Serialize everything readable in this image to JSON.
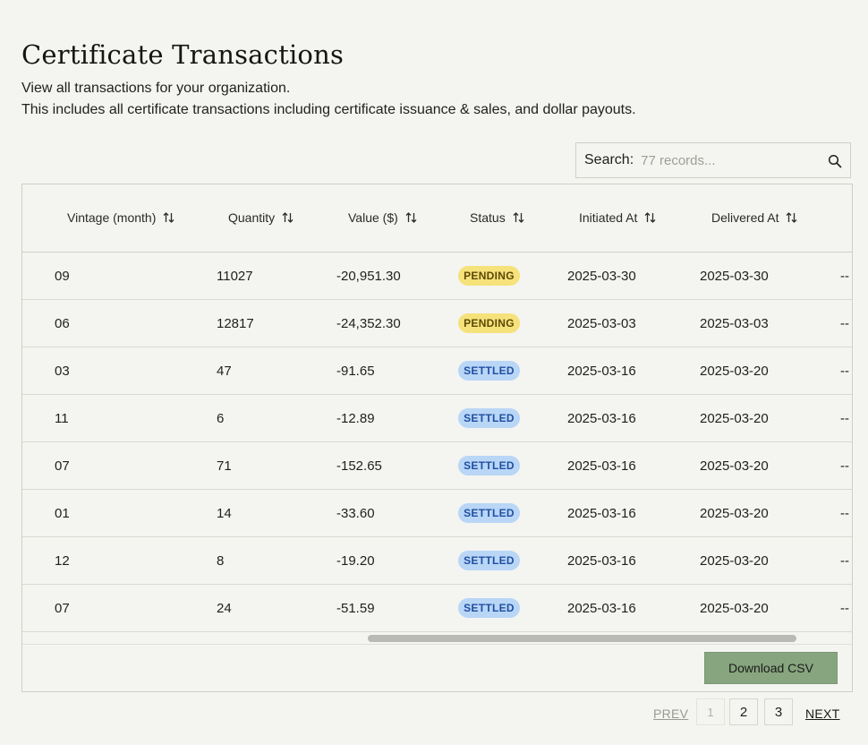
{
  "page": {
    "title": "Certificate Transactions",
    "subtitle_line1": "View all transactions for your organization.",
    "subtitle_line2": "This includes all certificate transactions including certificate issuance & sales, and dollar payouts."
  },
  "search": {
    "label": "Search:",
    "placeholder": "77 records..."
  },
  "table": {
    "columns": [
      "Vintage (month)",
      "Quantity",
      "Value ($)",
      "Status",
      "Initiated At",
      "Delivered At"
    ],
    "rows": [
      {
        "vintage": "09",
        "quantity": "11027",
        "value": "-20,951.30",
        "status": "PENDING",
        "initiated": "2025-03-30",
        "delivered": "2025-03-30",
        "extra": "--"
      },
      {
        "vintage": "06",
        "quantity": "12817",
        "value": "-24,352.30",
        "status": "PENDING",
        "initiated": "2025-03-03",
        "delivered": "2025-03-03",
        "extra": "--"
      },
      {
        "vintage": "03",
        "quantity": "47",
        "value": "-91.65",
        "status": "SETTLED",
        "initiated": "2025-03-16",
        "delivered": "2025-03-20",
        "extra": "--"
      },
      {
        "vintage": "11",
        "quantity": "6",
        "value": "-12.89",
        "status": "SETTLED",
        "initiated": "2025-03-16",
        "delivered": "2025-03-20",
        "extra": "--"
      },
      {
        "vintage": "07",
        "quantity": "71",
        "value": "-152.65",
        "status": "SETTLED",
        "initiated": "2025-03-16",
        "delivered": "2025-03-20",
        "extra": "--"
      },
      {
        "vintage": "01",
        "quantity": "14",
        "value": "-33.60",
        "status": "SETTLED",
        "initiated": "2025-03-16",
        "delivered": "2025-03-20",
        "extra": "--"
      },
      {
        "vintage": "12",
        "quantity": "8",
        "value": "-19.20",
        "status": "SETTLED",
        "initiated": "2025-03-16",
        "delivered": "2025-03-20",
        "extra": "--"
      },
      {
        "vintage": "07",
        "quantity": "24",
        "value": "-51.59",
        "status": "SETTLED",
        "initiated": "2025-03-16",
        "delivered": "2025-03-20",
        "extra": "--"
      }
    ]
  },
  "actions": {
    "download_label": "Download CSV"
  },
  "pagination": {
    "prev": "PREV",
    "pages": [
      "1",
      "2",
      "3"
    ],
    "current": "1",
    "next": "NEXT"
  },
  "colors": {
    "background": "#f4f4f0",
    "accent_button": "#87a57f",
    "pending_badge": "#f6e27a",
    "settled_badge": "#b9d6f7"
  },
  "icons": {
    "search": "search-icon",
    "sort": "sort-arrows-icon"
  }
}
